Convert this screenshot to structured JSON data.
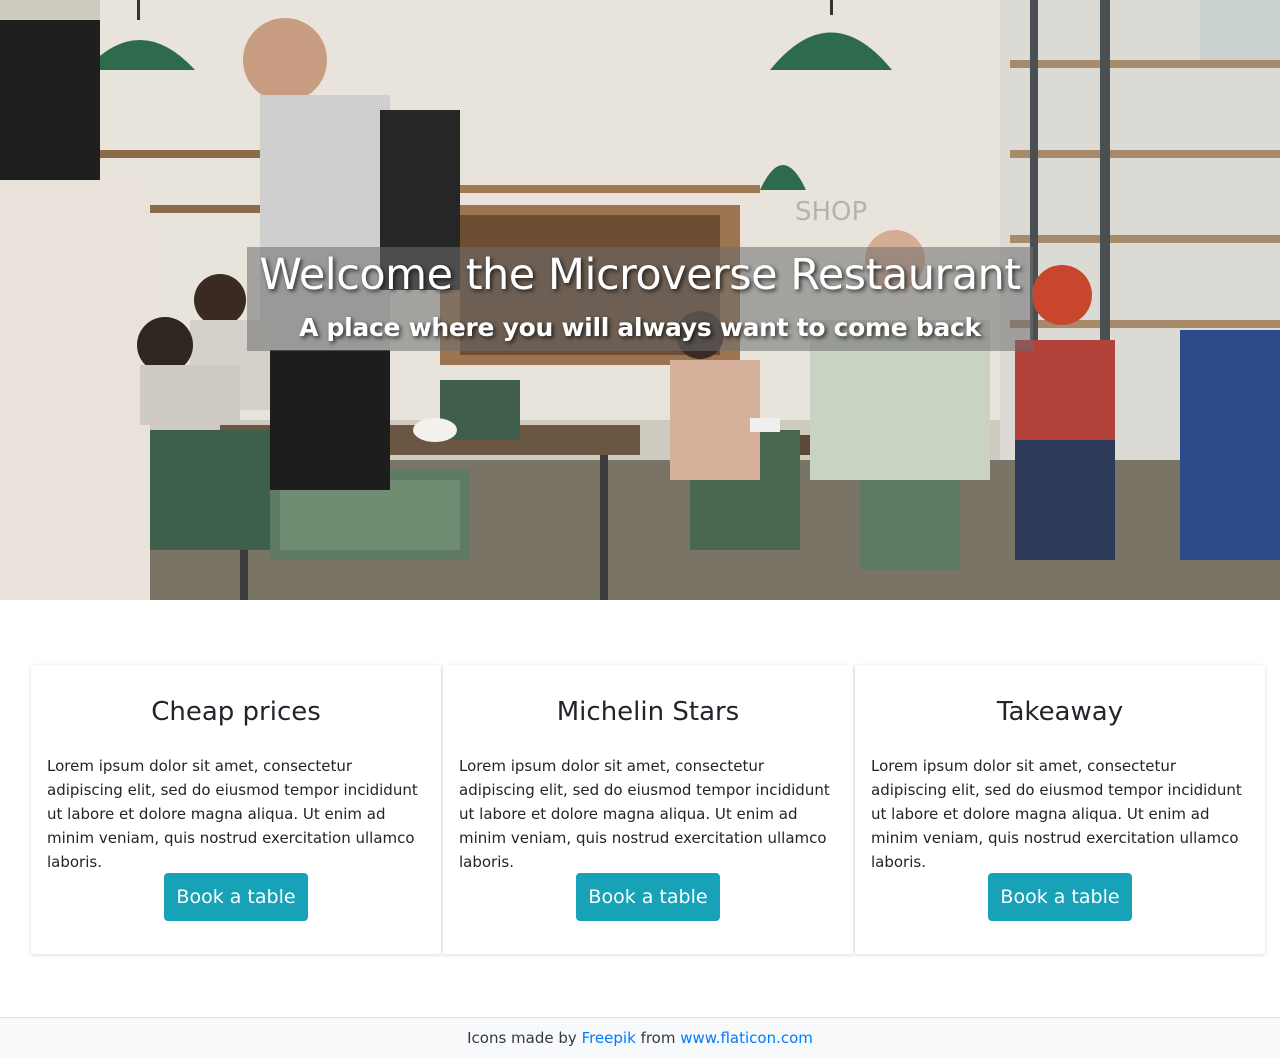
{
  "hero": {
    "title": "Welcome the Microverse Restaurant",
    "subtitle": "A place where you will always want to come back",
    "image": "restaurant-interior-photo"
  },
  "cards": [
    {
      "title": "Cheap prices",
      "text": "Lorem ipsum dolor sit amet, consectetur adipiscing elit, sed do eiusmod tempor incididunt ut labore et dolore magna aliqua. Ut enim ad minim veniam, quis nostrud exercitation ullamco laboris.",
      "button": "Book a table"
    },
    {
      "title": "Michelin Stars",
      "text": "Lorem ipsum dolor sit amet, consectetur adipiscing elit, sed do eiusmod tempor incididunt ut labore et dolore magna aliqua. Ut enim ad minim veniam, quis nostrud exercitation ullamco laboris.",
      "button": "Book a table"
    },
    {
      "title": "Takeaway",
      "text": "Lorem ipsum dolor sit amet, consectetur adipiscing elit, sed do eiusmod tempor incididunt ut labore et dolore magna aliqua. Ut enim ad minim veniam, quis nostrud exercitation ullamco laboris.",
      "button": "Book a table"
    }
  ],
  "footer": {
    "prefix": "Icons made by",
    "author_link": "Freepik",
    "middle": "from",
    "site_link": "www.flaticon.com"
  },
  "colors": {
    "button": "#17a2b8",
    "link": "#007bff",
    "footer_bg": "#f8f9fa"
  }
}
